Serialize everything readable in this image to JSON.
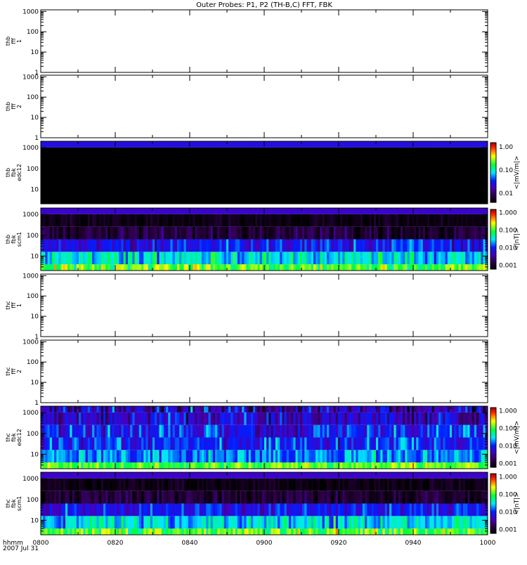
{
  "chart_data": {
    "type": "heatmap",
    "title": "Outer Probes: P1, P2 (TH-B,C) FFT, FBK",
    "x_tick_labels": [
      "0800",
      "0820",
      "0840",
      "0900",
      "0920",
      "0940",
      "1000"
    ],
    "x_axis_label": "hhmm",
    "date_label": "2007 Jul 31",
    "x_range": [
      "0800",
      "1000"
    ],
    "panels": [
      {
        "label": [
          "thb",
          "fff",
          "1"
        ],
        "yrange": [
          1,
          1200
        ],
        "yticks": [
          "1",
          "10",
          "100",
          "1000"
        ],
        "kind": "empty"
      },
      {
        "label": [
          "thb",
          "fff",
          "2"
        ],
        "yrange": [
          1,
          1200
        ],
        "yticks": [
          "1",
          "10",
          "100",
          "1000"
        ],
        "kind": "empty"
      },
      {
        "label": [
          "thb",
          "fbk",
          "edc12"
        ],
        "yrange": [
          2,
          2048
        ],
        "yticks": [
          "10",
          "100",
          "1000"
        ],
        "kind": "spec",
        "colorbar": {
          "range": [
            0.004,
            1.5
          ],
          "ticks": [
            "0.01",
            "0.10",
            "1.00"
          ],
          "tick_values": [
            0.01,
            0.1,
            1
          ],
          "unit": "<|mV/m|>"
        },
        "bands": [
          {
            "f": [
              2,
              1024
            ],
            "level": 0.0001,
            "spread": 0
          },
          {
            "f": [
              1024,
              2048
            ],
            "level": 0.025,
            "spread": 0
          }
        ]
      },
      {
        "label": [
          "thb",
          "fbk",
          "scm1"
        ],
        "yrange": [
          2,
          2048
        ],
        "yticks": [
          "10",
          "100",
          "1000"
        ],
        "kind": "spec",
        "colorbar": {
          "range": [
            0.0006,
            1.5
          ],
          "ticks": [
            "0.001",
            "0.010",
            "0.100",
            "1.000"
          ],
          "tick_values": [
            0.001,
            0.01,
            0.1,
            1
          ],
          "unit": "<|nT|>"
        },
        "bands": [
          {
            "f": [
              2,
              4
            ],
            "level": 0.12,
            "spread": 0.35
          },
          {
            "f": [
              4,
              16
            ],
            "level": 0.03,
            "spread": 0.35
          },
          {
            "f": [
              16,
              64
            ],
            "level": 0.008,
            "spread": 0.3
          },
          {
            "f": [
              64,
              256
            ],
            "level": 0.0012,
            "spread": 0.25
          },
          {
            "f": [
              256,
              1024
            ],
            "level": 0.0008,
            "spread": 0.15
          },
          {
            "f": [
              1024,
              2048
            ],
            "level": 0.005,
            "spread": 0
          }
        ]
      },
      {
        "label": [
          "thc",
          "fff",
          "1"
        ],
        "yrange": [
          1,
          1200
        ],
        "yticks": [
          "1",
          "10",
          "100",
          "1000"
        ],
        "kind": "empty"
      },
      {
        "label": [
          "thc",
          "fff",
          "2"
        ],
        "yrange": [
          1,
          1200
        ],
        "yticks": [
          "1",
          "10",
          "100",
          "1000"
        ],
        "kind": "empty"
      },
      {
        "label": [
          "thc",
          "fbk",
          "edc12"
        ],
        "yrange": [
          2,
          2048
        ],
        "yticks": [
          "10",
          "100",
          "1000"
        ],
        "kind": "spec",
        "colorbar": {
          "range": [
            0.0006,
            1.5
          ],
          "ticks": [
            "0.001",
            "0.010",
            "0.100",
            "1.000"
          ],
          "tick_values": [
            0.001,
            0.01,
            0.1,
            1
          ],
          "unit": "<|mV/m|>"
        },
        "bands": [
          {
            "f": [
              2,
              4
            ],
            "level": 0.12,
            "spread": 0.25
          },
          {
            "f": [
              4,
              16
            ],
            "level": 0.02,
            "spread": 0.3
          },
          {
            "f": [
              16,
              64
            ],
            "level": 0.01,
            "spread": 0.35
          },
          {
            "f": [
              64,
              256
            ],
            "level": 0.008,
            "spread": 0.4
          },
          {
            "f": [
              256,
              1024
            ],
            "level": 0.005,
            "spread": 0.4
          },
          {
            "f": [
              1024,
              2048
            ],
            "level": 0.004,
            "spread": 0.5
          }
        ]
      },
      {
        "label": [
          "thc",
          "fbk",
          "scm1"
        ],
        "yrange": [
          2,
          2048
        ],
        "yticks": [
          "10",
          "100",
          "1000"
        ],
        "kind": "spec",
        "colorbar": {
          "range": [
            0.0006,
            1.5
          ],
          "ticks": [
            "0.001",
            "0.010",
            "0.100",
            "1.000"
          ],
          "tick_values": [
            0.001,
            0.01,
            0.1,
            1
          ],
          "unit": "<|nT|>"
        },
        "bands": [
          {
            "f": [
              2,
              4
            ],
            "level": 0.12,
            "spread": 0.35
          },
          {
            "f": [
              4,
              16
            ],
            "level": 0.03,
            "spread": 0.35
          },
          {
            "f": [
              16,
              64
            ],
            "level": 0.008,
            "spread": 0.3
          },
          {
            "f": [
              64,
              256
            ],
            "level": 0.0012,
            "spread": 0.25
          },
          {
            "f": [
              256,
              1024
            ],
            "level": 0.0008,
            "spread": 0.15
          },
          {
            "f": [
              1024,
              2048
            ],
            "level": 0.005,
            "spread": 0
          }
        ]
      }
    ]
  }
}
